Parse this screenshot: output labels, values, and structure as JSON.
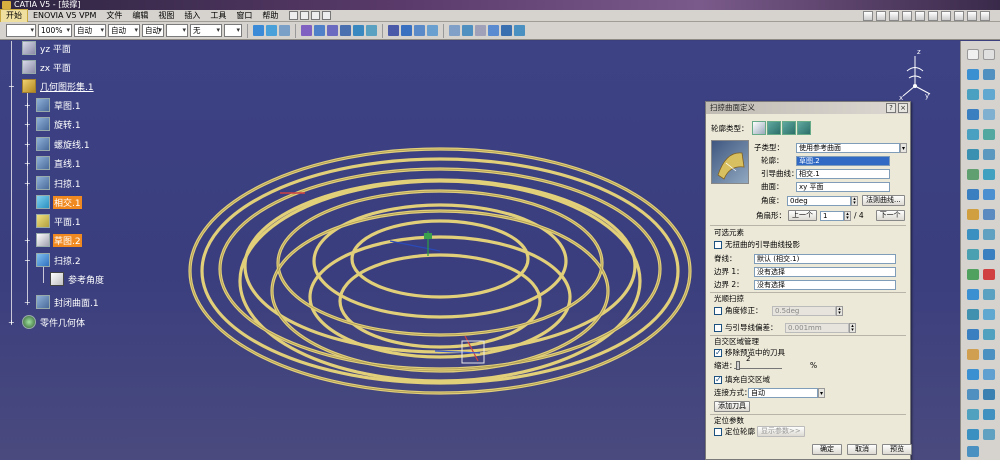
{
  "window": {
    "title": "CATIA V5 - [鼓撑]"
  },
  "menu": {
    "start": "开始",
    "items": [
      "ENOVIA V5 VPM",
      "文件",
      "编辑",
      "视图",
      "插入",
      "工具",
      "窗口",
      "帮助"
    ]
  },
  "toolbar": {
    "color_combo": "",
    "zoom_combo": "100%",
    "auto1": "自动",
    "auto2": "自动",
    "auto3": "自动",
    "combo5": "",
    "none": "无",
    "combo7": ""
  },
  "tree": {
    "items": [
      {
        "label": "yz 平面"
      },
      {
        "label": "zx 平面"
      },
      {
        "label": "几何图形集.1"
      },
      {
        "label": "草图.1"
      },
      {
        "label": "旋转.1"
      },
      {
        "label": "螺旋线.1"
      },
      {
        "label": "直线.1"
      },
      {
        "label": "扫掠.1"
      },
      {
        "label": "相交.1"
      },
      {
        "label": "平面.1"
      },
      {
        "label": "草图.2"
      },
      {
        "label": "扫掠.2"
      },
      {
        "label": "参考角度"
      },
      {
        "label": "封闭曲面.1"
      },
      {
        "label": "零件几何体"
      }
    ]
  },
  "dialog": {
    "title": "扫掠曲面定义",
    "profile_type_label": "轮廓类型：",
    "subtype_label": "子类型：",
    "subtype_value": "使用参考曲面",
    "profile_label": "轮廓：",
    "profile_value": "草图.2",
    "guide_label": "引导曲线：",
    "guide_value": "相交.1",
    "surface_label": "曲面：",
    "surface_value": "xy 平面",
    "angle_label": "角度：",
    "angle_value": "0deg",
    "law_button": "法则曲线...",
    "angle_sector_label": "角扇形：",
    "prev_button": "上一个",
    "sector_value": "1",
    "sector_total": "/ 4",
    "next_button": "下一个",
    "optional_title": "可选元素",
    "project_guide_label": "无扭曲的引导曲线投影",
    "spine_label": "脊线：",
    "spine_value": "默认 (相交.1)",
    "boundary1_label": "边界 1：",
    "boundary1_value": "没有选择",
    "boundary2_label": "边界 2：",
    "boundary2_value": "没有选择",
    "smooth_title": "光顺扫掠",
    "angle_correction_label": "角度修正：",
    "angle_correction_value": "0.5deg",
    "deviation_label": "与引导线偏差：",
    "deviation_value": "0.001mm",
    "self_intersect_title": "自交区域管理",
    "remove_tools_label": "移除预览中的刀具",
    "setback_label": "缩进：",
    "setback_value": "2",
    "setback_unit": "%",
    "fill_label": "填充自交区域",
    "connection_label": "连接方式：",
    "connection_value": "自动",
    "add_tool_button": "添加刀具",
    "position_title": "定位参数",
    "position_profile_label": "定位轮廓",
    "show_params_button": "显示参数>>",
    "ok_button": "确定",
    "cancel_button": "取消",
    "preview_button": "预览"
  }
}
